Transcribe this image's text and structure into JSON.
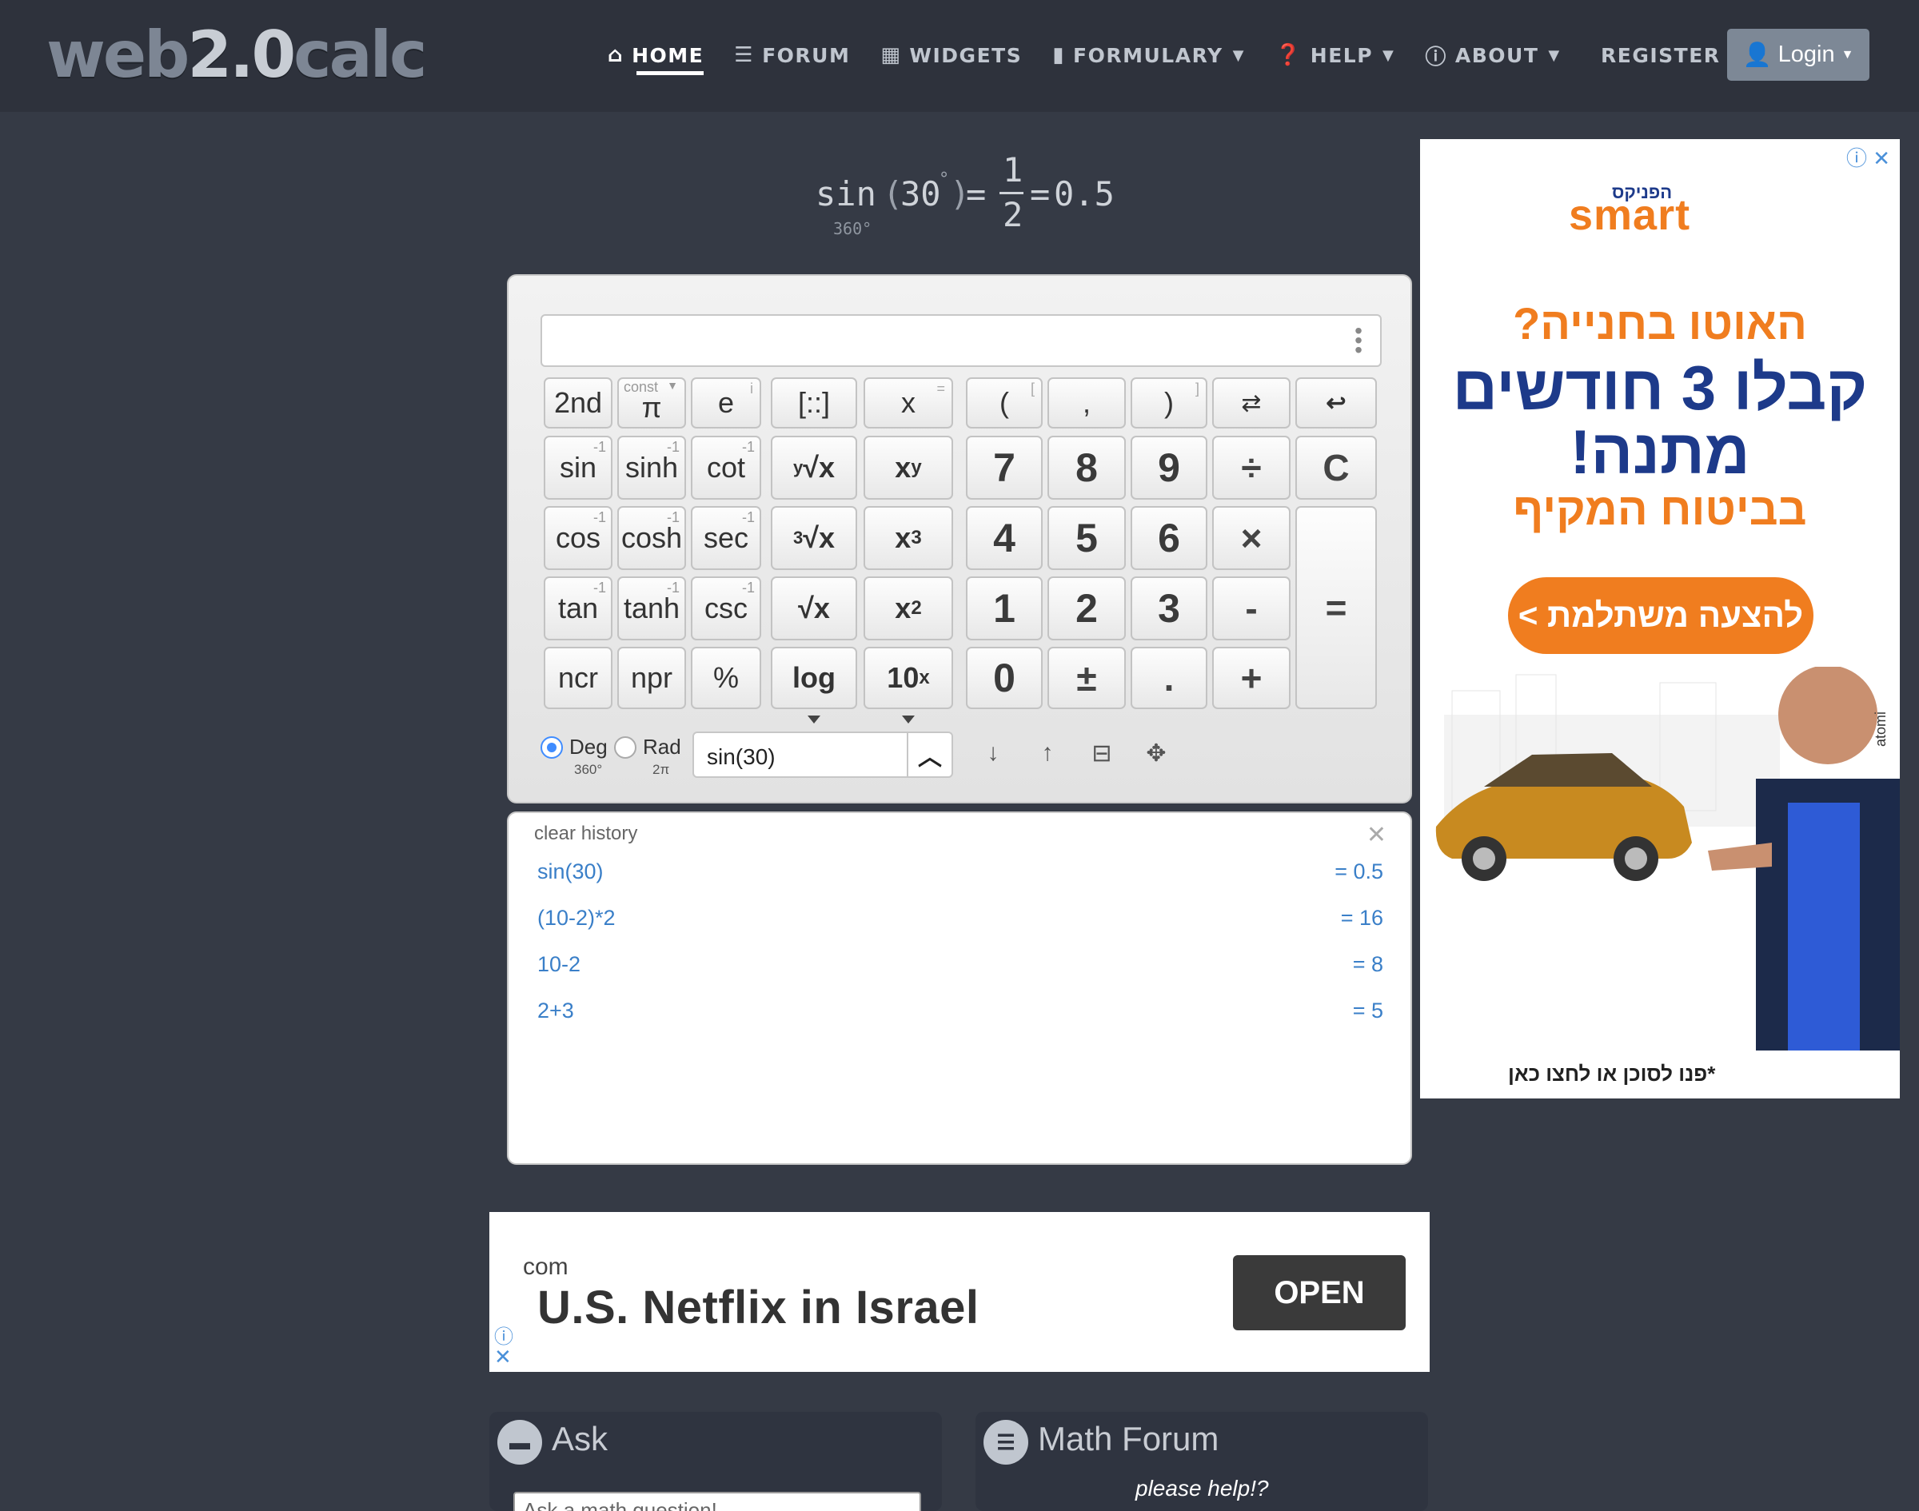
{
  "navbar": {
    "logo_prefix": "web",
    "logo_mid": "2.0",
    "logo_suffix": "calc",
    "items": [
      {
        "label": "HOME",
        "icon": "home-icon"
      },
      {
        "label": "FORUM",
        "icon": "list-icon"
      },
      {
        "label": "WIDGETS",
        "icon": "calendar-icon"
      },
      {
        "label": "FORMULARY",
        "icon": "book-icon"
      },
      {
        "label": "HELP",
        "icon": "question-circle-icon"
      },
      {
        "label": "ABOUT",
        "icon": "info-circle-icon"
      }
    ],
    "register": "REGISTER",
    "login": "Login"
  },
  "result": {
    "func": "sin",
    "open": "(",
    "arg": "30",
    "deg": "°",
    "close": ")",
    "eq1": "=",
    "num": "1",
    "den": "2",
    "eq2": "=",
    "value": "0.5",
    "mode_sub": "360°"
  },
  "calculator": {
    "input_value": "",
    "keys": {
      "second": "2nd",
      "const_label": "const",
      "pi": "π",
      "e": "e",
      "matrix": "[::]",
      "x": "x",
      "lparen": "(",
      "comma": ",",
      "rparen": ")",
      "swap": "⇄",
      "backspace": "↩",
      "sin": "sin",
      "sinh": "sinh",
      "cot": "cot",
      "yroot": "√x",
      "yroot_pre": "y",
      "xy": "x",
      "xy_sup": "y",
      "seven": "7",
      "eight": "8",
      "nine": "9",
      "divide": "÷",
      "clear": "C",
      "cos": "cos",
      "cosh": "cosh",
      "sec": "sec",
      "croot": "√x",
      "croot_pre": "3",
      "x3": "x",
      "x3_sup": "3",
      "four": "4",
      "five": "5",
      "six": "6",
      "times": "×",
      "tan": "tan",
      "tanh": "tanh",
      "csc": "csc",
      "sqrt": "√x",
      "x2": "x",
      "x2_sup": "2",
      "one": "1",
      "two": "2",
      "three": "3",
      "minus": "-",
      "equals": "=",
      "ncr": "ncr",
      "npr": "npr",
      "percent": "%",
      "log": "log",
      "tenx": "10",
      "tenx_sup": "x",
      "zero": "0",
      "plusminus": "±",
      "dot": ".",
      "plus": "+",
      "inv": "-1"
    },
    "mode": {
      "deg_label": "Deg",
      "deg_sub": "360°",
      "rad_label": "Rad",
      "rad_sub": "2π",
      "selected": "Deg"
    },
    "expression": "sin(30)"
  },
  "history": {
    "clear_label": "clear history",
    "rows": [
      {
        "expr": "sin(30)",
        "value": "= 0.5"
      },
      {
        "expr": "(10-2)*2",
        "value": "= 16"
      },
      {
        "expr": "10-2",
        "value": "= 8"
      },
      {
        "expr": "2+3",
        "value": "= 5"
      }
    ]
  },
  "ad_right": {
    "brand_small": "הפניקס",
    "brand": "smart",
    "line1": "האוטו בחנייה?",
    "line2": "קבלו 3 חודשים",
    "line3": "מתנה!",
    "line4": "בביטוח המקיף",
    "cta": "להצעה משתלמת >",
    "footnote": "*פנו לסוכן או לחצו כאן",
    "network": "atomi",
    "colors": {
      "orange": "#f07d1f",
      "blue": "#1d3a8a"
    }
  },
  "ad_bottom": {
    "domain": "com",
    "headline": "U.S. Netflix in Israel",
    "button": "OPEN"
  },
  "panels": {
    "ask_title": "Ask",
    "ask_placeholder": "Ask a math question!",
    "forum_title": "Math Forum",
    "forum_sub": "please help!?"
  }
}
